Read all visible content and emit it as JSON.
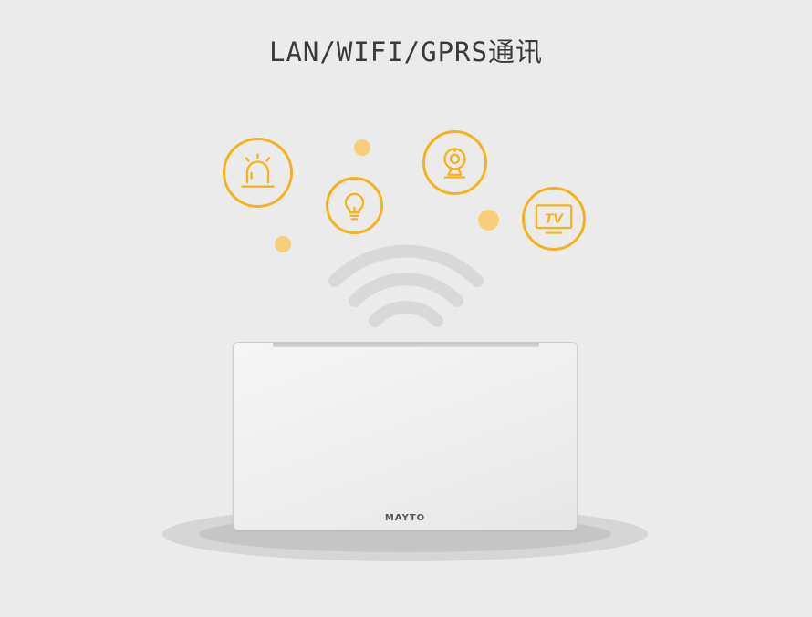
{
  "title": "LAN/WIFI/GPRS通讯",
  "brand": "MAYTO",
  "colors": {
    "accent": "#f5b21c",
    "accent_light": "#f7cf7a",
    "background": "#ebebeb",
    "wifi": "#d9d9d9"
  },
  "icons": [
    "alarm-icon",
    "light-bulb-icon",
    "webcam-icon",
    "tv-icon"
  ],
  "tv_label": "TV"
}
